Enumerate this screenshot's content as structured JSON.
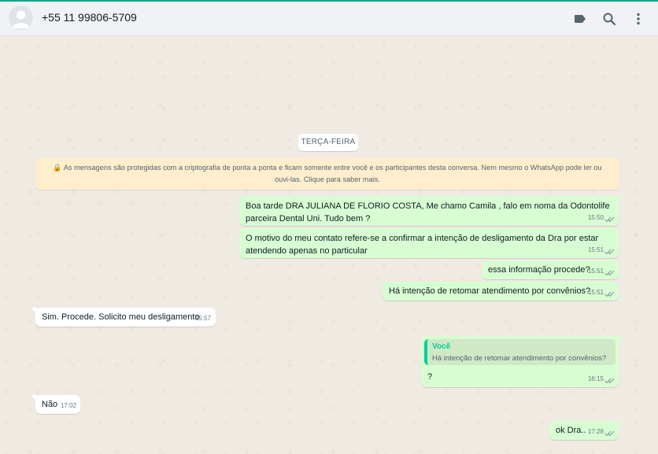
{
  "header": {
    "contact_name": "+55 11 99806-5709",
    "icons": [
      "label-icon",
      "search-icon",
      "menu-icon"
    ]
  },
  "chat": {
    "date_label": "TERÇA-FEIRA",
    "encryption_notice_line1": "🔒 As mensagens são protegidas com a criptografia de ponta a ponta e ficam somente entre você e os participantes desta conversa. Nem mesmo o WhatsApp pode ler ou",
    "encryption_notice_line2": "ouvi-las. Clique para saber mais.",
    "messages": [
      {
        "direction": "out",
        "line1": "Boa tarde DRA JULIANA DE FLORIO COSTA, Me chamo Camila , falo em noma da Odontolife",
        "line2": "parceira Dental Uni. Tudo bem ?",
        "time": "15:50"
      },
      {
        "direction": "out",
        "line1": "O motivo do meu contato refere-se a confirmar a intenção de desligamento da Dra por estar",
        "line2": "atendendo apenas no particular",
        "time": "15:51"
      },
      {
        "direction": "out",
        "text": "essa informação procede?",
        "time": "15:51"
      },
      {
        "direction": "out",
        "text": "Há intenção de retomar atendimento por convênios?",
        "time": "15:51"
      },
      {
        "direction": "in",
        "text": "Sim. Procede. Solicito meu desligamento",
        "time": "15:57"
      },
      {
        "direction": "out",
        "quote_author": "Você",
        "quote_text": "Há intenção de retomar atendimento por convênios?",
        "text": "?",
        "time": "16:15"
      },
      {
        "direction": "in",
        "text": "Não",
        "time": "17:02"
      },
      {
        "direction": "out",
        "text": "ok Dra..",
        "time": "17:28"
      }
    ]
  },
  "colors": {
    "accent": "#00a884",
    "outgoing_bubble": "#d9fdd3",
    "incoming_bubble": "#ffffff",
    "read_ticks": "#8696a0",
    "encryption_bg": "#ffeecd"
  }
}
